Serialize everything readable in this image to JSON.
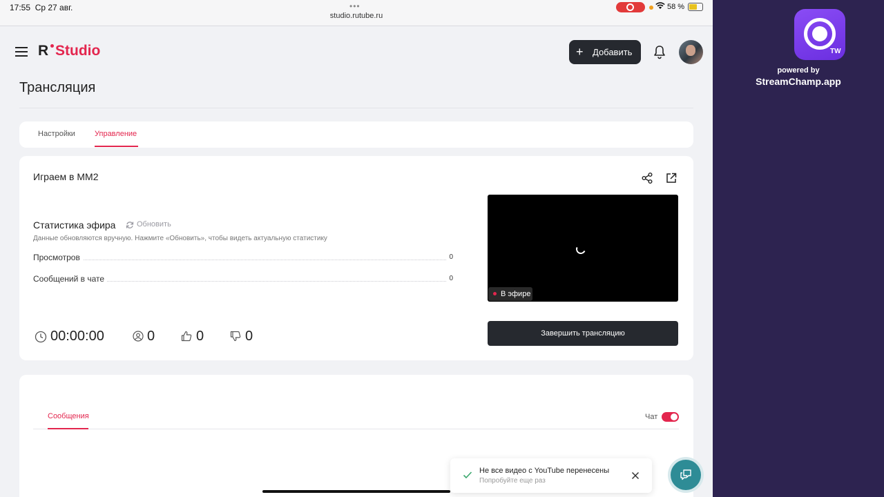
{
  "status_bar": {
    "time": "17:55",
    "date": "Ср 27 авг.",
    "url": "studio.rutube.ru",
    "battery": "58 %"
  },
  "header": {
    "logo_r": "R",
    "logo_studio": "Studio",
    "add_label": "Добавить"
  },
  "page": {
    "title": "Трансляция"
  },
  "tabs": [
    {
      "label": "Настройки",
      "active": false
    },
    {
      "label": "Управление",
      "active": true
    }
  ],
  "stream": {
    "title": "Играем в MM2",
    "stats_title": "Статистика эфира",
    "refresh_label": "Обновить",
    "stats_hint": "Данные обновляются вручную. Нажмите «Обновить», чтобы видеть актуальную статистику",
    "stats": [
      {
        "label": "Просмотров",
        "value": "0"
      },
      {
        "label": "Сообщений в чате",
        "value": "0"
      }
    ],
    "timer": "00:00:00",
    "viewers": "0",
    "likes": "0",
    "dislikes": "0",
    "live_label": "В эфире",
    "end_button": "Завершить трансляцию"
  },
  "chat": {
    "tab_label": "Сообщения",
    "toggle_label": "Чат",
    "toggle_on": true
  },
  "toast": {
    "title": "Не все видео с YouTube перенесены",
    "subtitle": "Попробуйте еще раз"
  },
  "side_panel": {
    "app_badge": "TW",
    "powered_by": "powered by",
    "brand": "StreamChamp.app"
  },
  "colors": {
    "accent": "#e3264e",
    "dark_button": "#26292f",
    "side_bg": "#2d2350",
    "help_btn": "#2e8c96"
  }
}
